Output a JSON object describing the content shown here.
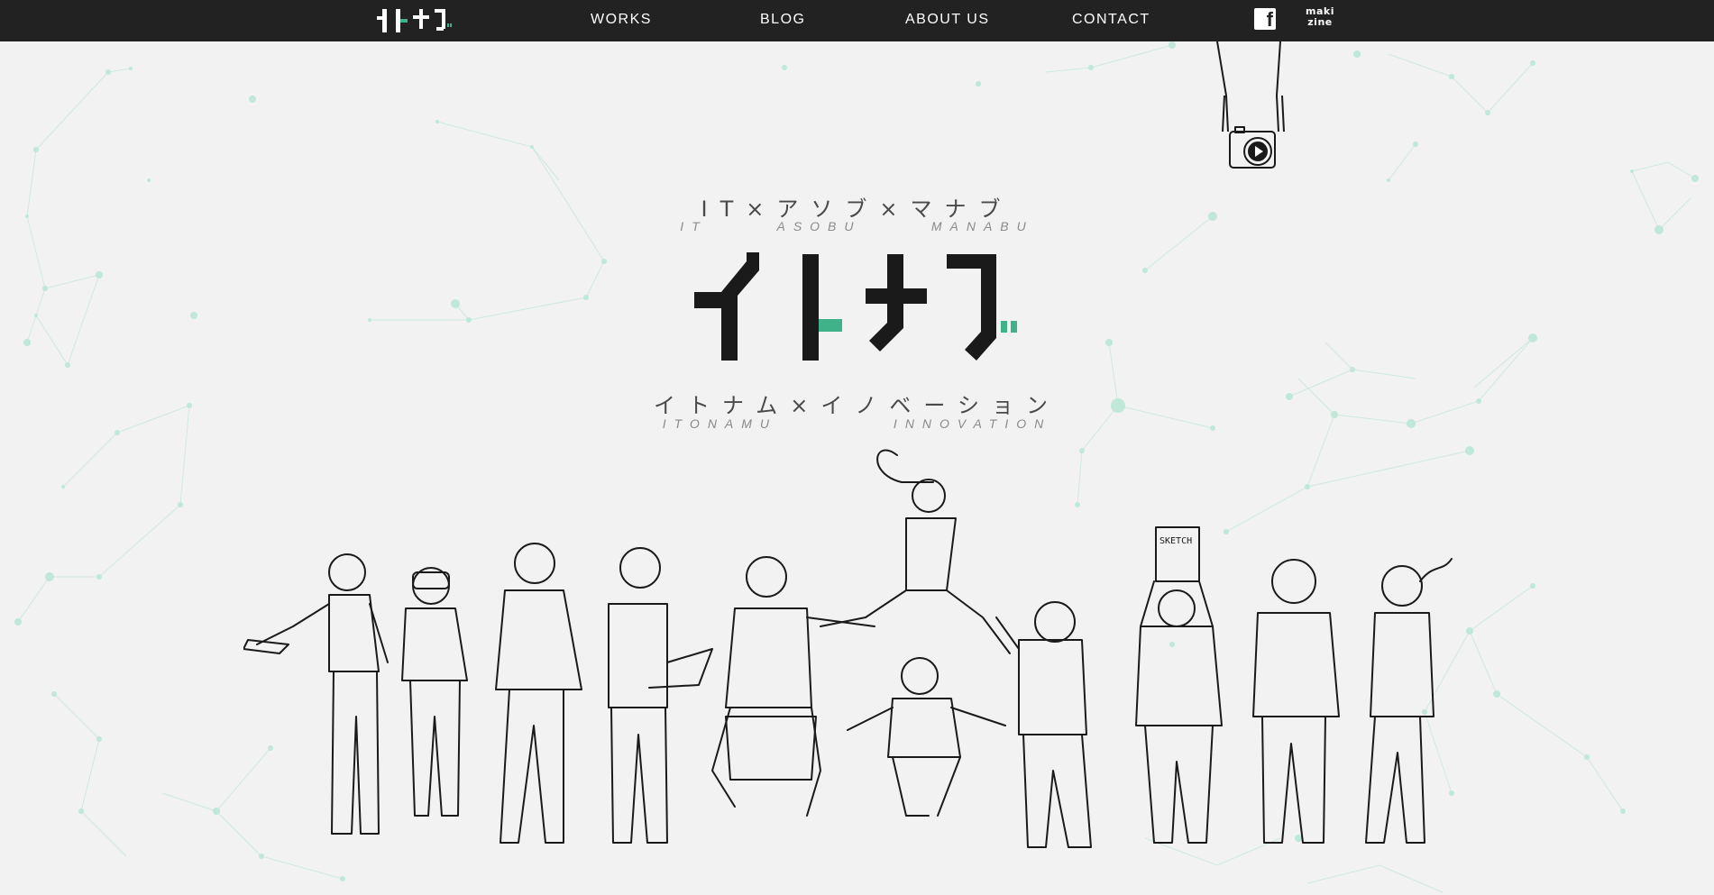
{
  "header": {
    "logo_label": "イトナブ",
    "nav": [
      {
        "label": "WORKS"
      },
      {
        "label": "BLOG"
      },
      {
        "label": "ABOUT US"
      },
      {
        "label": "CONTACT"
      }
    ],
    "social": {
      "facebook_icon": "facebook-icon",
      "makizine_icon": "makizine-logo",
      "makizine_text_1": "maki",
      "makizine_text_2": "zine"
    }
  },
  "hero": {
    "tagline_top_jp": "IT×アソブ×マナブ",
    "tagline_top_en": "IT      ASOBU      MANABU",
    "logo_label": "イトナブ",
    "tagline_bottom_jp": "イトナム×イノベーション",
    "tagline_bottom_en": "ITONAMU          INNOVATION",
    "camera_icon": "camera-play-icon",
    "illustration_label": "sketch-people-illustration",
    "sketch_board_text": "SKETCH"
  },
  "colors": {
    "accent": "#3fb28a",
    "header_bg": "#222222",
    "page_bg": "#f2f2f2",
    "ink": "#1a1a1a",
    "network": "#a8e3cf"
  }
}
